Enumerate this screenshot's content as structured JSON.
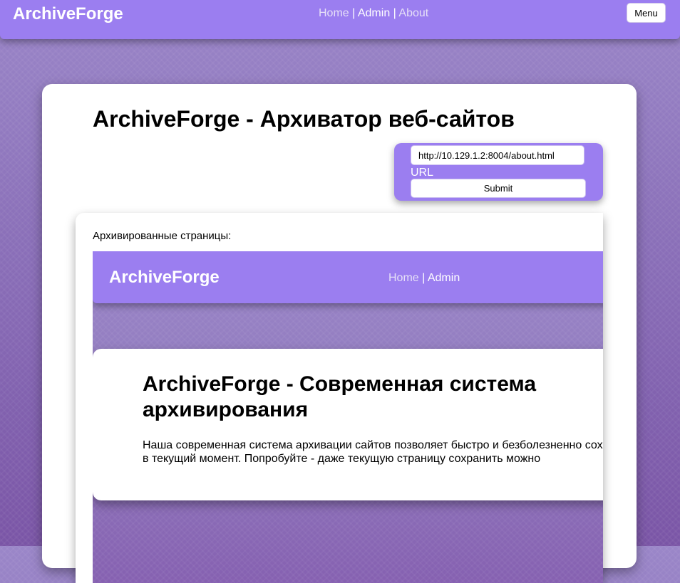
{
  "header": {
    "logo": "ArchiveForge",
    "nav": {
      "home": "Home",
      "sep": "|",
      "admin": "Admin",
      "about": "About"
    },
    "menu_button": "Menu"
  },
  "main": {
    "title": "ArchiveForge - Архиватор веб-сайтов",
    "form": {
      "url_value": "http://10.129.1.2:8004/about.html",
      "url_label": "URL",
      "submit_label": "Submit"
    },
    "archived_label": "Архивированные страницы:"
  },
  "archived_page": {
    "logo": "ArchiveForge",
    "nav": {
      "home": "Home",
      "sep": "|",
      "admin": "Admin"
    },
    "title": "ArchiveForge - Современная система архивирования",
    "text": "Наша современная система архивации сайтов позволяет быстро и безболезненно сохранить копии сайтов в текущий момент. Попробуйте - даже текущую страницу сохранить можно"
  },
  "colors": {
    "accent": "#9b7ef0",
    "background": "#8a6fb8"
  }
}
